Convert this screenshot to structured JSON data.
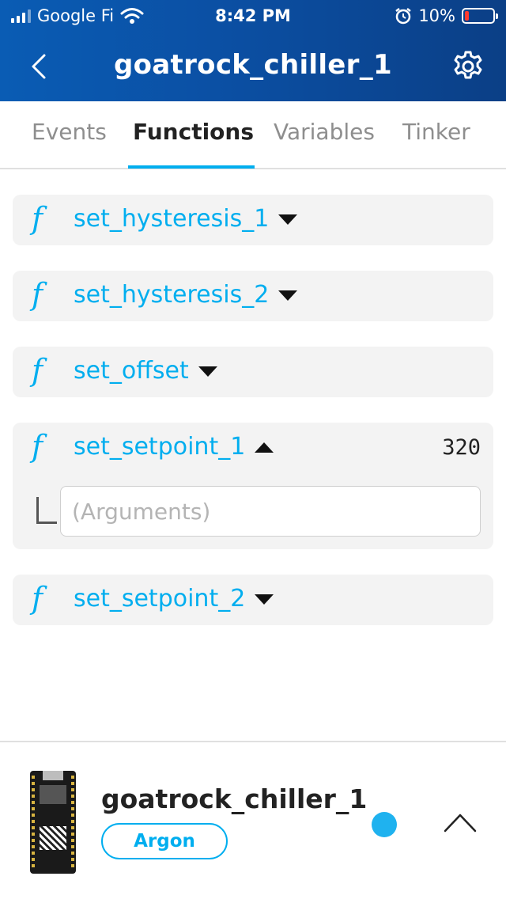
{
  "status_bar": {
    "carrier": "Google Fi",
    "time": "8:42 PM",
    "battery": "10%"
  },
  "header": {
    "title": "goatrock_chiller_1",
    "accent_color": "#0a5cb4"
  },
  "tabs": [
    {
      "label": "Events",
      "active": false
    },
    {
      "label": "Functions",
      "active": true
    },
    {
      "label": "Variables",
      "active": false
    },
    {
      "label": "Tinker",
      "active": false
    }
  ],
  "functions": [
    {
      "icon": "f",
      "name": "set_hysteresis_1",
      "expanded": false
    },
    {
      "icon": "f",
      "name": "set_hysteresis_2",
      "expanded": false
    },
    {
      "icon": "f",
      "name": "set_offset",
      "expanded": false
    },
    {
      "icon": "f",
      "name": "set_setpoint_1",
      "expanded": true,
      "result": "320",
      "arguments_placeholder": "(Arguments)"
    },
    {
      "icon": "f",
      "name": "set_setpoint_2",
      "expanded": false
    }
  ],
  "device": {
    "name": "goatrock_chiller_1",
    "type": "Argon",
    "status_color": "#1fb2ef"
  }
}
